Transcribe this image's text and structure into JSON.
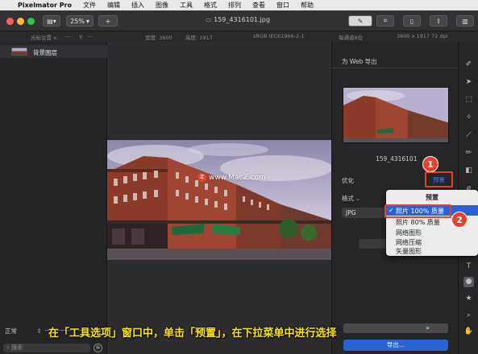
{
  "menubar": {
    "apple": "",
    "app_name": "Pixelmator Pro",
    "items": [
      "文件",
      "编辑",
      "插入",
      "图像",
      "工具",
      "格式",
      "排列",
      "查看",
      "窗口",
      "帮助"
    ]
  },
  "toolbar": {
    "zoom": "25%",
    "add": "+",
    "filename": "159_4316101.jpg"
  },
  "infobar": {
    "cursor_label": "光标位置 x:",
    "cursor_x": "---",
    "cursor_y_label": "y:",
    "cursor_y": "---",
    "width_label": "宽度: 3600",
    "height_label": "高度: 1917",
    "color_profile": "sRGB IEC61966-2.1",
    "channel": "每通道8位",
    "dimensions": "3600 x 1917 72 dpi"
  },
  "layers": {
    "items": [
      {
        "label": "背景图层"
      }
    ]
  },
  "canvas": {
    "watermark": "www.MacZ.com",
    "watermark_mark": "Z"
  },
  "export_panel": {
    "title": "为 Web 导出",
    "preview_name": "159_4316101",
    "optimize_label": "优化",
    "preset_button": "预置",
    "format_label": "格式",
    "format_value": "JPG",
    "export_button": "导出..."
  },
  "preset_menu": {
    "header": "预置",
    "items": [
      {
        "label": "照片 100% 质量",
        "checked": true
      },
      {
        "label": "照片 80% 质量",
        "checked": false
      },
      {
        "label": "网络图形",
        "checked": false
      },
      {
        "label": "网络压缩",
        "checked": false
      },
      {
        "label": "矢量图形",
        "checked": false
      }
    ],
    "check": "✓"
  },
  "bottom_bar": {
    "blend_mode": "正常",
    "search_placeholder": "搜索"
  },
  "annotations": {
    "step1": "1",
    "step2": "2",
    "caption": "在「工具选项」窗口中，单击「预置」，在下拉菜单中进行选择"
  },
  "colors": {
    "accent": "#2a62d4",
    "highlight_box": "#e2432f",
    "caption": "#ffe600"
  }
}
